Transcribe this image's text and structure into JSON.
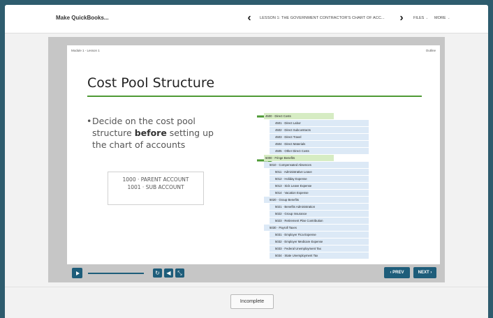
{
  "header": {
    "course_title": "Make QuickBooks...",
    "lesson_title": "LESSON 1: THE GOVERNMENT CONTRACTOR'S CHART OF ACC...",
    "files_label": "FILES",
    "more_label": "MORE",
    "caret": "⌄",
    "prev_arrow": "‹",
    "next_arrow": "›"
  },
  "slide": {
    "breadcrumb": "Module 1 - Lesson 1",
    "outline_label": "Outline",
    "title": "Cost Pool Structure",
    "bullet_pre": "Decide on the cost pool structure ",
    "bullet_bold": "before",
    "bullet_post": " setting up the chart of accounts",
    "account_parent": "1000 · PARENT ACCOUNT",
    "account_sub": "1001 · SUB ACCOUNT",
    "coa_rows": [
      {
        "text": "4500 · Direct Costs",
        "highlight": true
      },
      {
        "text": "4501 · Direct Labor",
        "highlight": false
      },
      {
        "text": "4502 · Direct Subcontracts",
        "highlight": false
      },
      {
        "text": "4503 · Direct Travel",
        "highlight": false
      },
      {
        "text": "4504 · Direct Materials",
        "highlight": false
      },
      {
        "text": "4505 · Other Direct Costs",
        "highlight": false
      },
      {
        "text": "5000 · Fringe Benefits",
        "highlight": true
      },
      {
        "text": "5010 · Compensated Absences",
        "highlight": false
      },
      {
        "text": "5011 · Administrative Leave",
        "highlight": false
      },
      {
        "text": "5012 · Holiday Expense",
        "highlight": false
      },
      {
        "text": "5013 · Sick Leave Expense",
        "highlight": false
      },
      {
        "text": "5014 · Vacation Expense",
        "highlight": false
      },
      {
        "text": "5020 · Group Benefits",
        "highlight": false
      },
      {
        "text": "5021 · Benefits Administration",
        "highlight": false
      },
      {
        "text": "5022 · Group Insurance",
        "highlight": false
      },
      {
        "text": "5023 · Retirement Plan Contribution",
        "highlight": false
      },
      {
        "text": "5030 · Payroll Taxes",
        "highlight": false
      },
      {
        "text": "5031 · Employer Fica Expense",
        "highlight": false
      },
      {
        "text": "5032 · Employer Medicare Expense",
        "highlight": false
      },
      {
        "text": "5033 · Federal Unemployment Tax",
        "highlight": false
      },
      {
        "text": "5034 · State Unemployment Tax",
        "highlight": false
      }
    ]
  },
  "controls": {
    "prev_label": "‹ PREV",
    "next_label": "NEXT ›",
    "replay_glyph": "↻",
    "volume_glyph": "◀",
    "fullscreen_glyph": "⤡"
  },
  "footer": {
    "incomplete_label": "Incomplete"
  },
  "colors": {
    "accent": "#1e5d7a",
    "title_rule": "#4e9a34",
    "outer_background": "#2e5c6e"
  }
}
